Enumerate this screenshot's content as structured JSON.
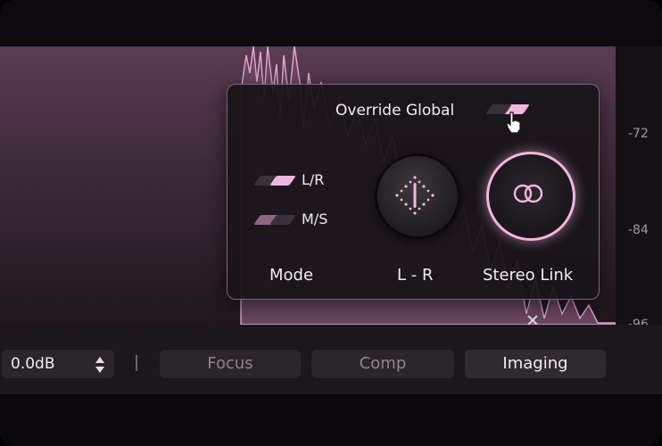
{
  "scale": {
    "labels": [
      "-72",
      "-84",
      "-96"
    ]
  },
  "panel": {
    "override_label": "Override Global",
    "mode": {
      "options": [
        "L/R",
        "M/S"
      ],
      "selected": "L/R",
      "label": "Mode"
    },
    "balance_label": "L - R",
    "stereo_link_label": "Stereo Link"
  },
  "toolbar": {
    "gain_value": "0.0dB",
    "separator": "|",
    "tabs": [
      {
        "label": "Focus",
        "active": false
      },
      {
        "label": "Comp",
        "active": false
      },
      {
        "label": "Imaging",
        "active": true
      }
    ]
  },
  "icons": {
    "balance": "crosshair-diamond-icon",
    "stereo_link": "linked-rings-icon",
    "cursor": "hand-pointer-icon",
    "stepper": "updown-arrows-icon"
  },
  "colors": {
    "accent": "#f2b6de",
    "panel_border": "#7a6674",
    "background": "#151216"
  }
}
